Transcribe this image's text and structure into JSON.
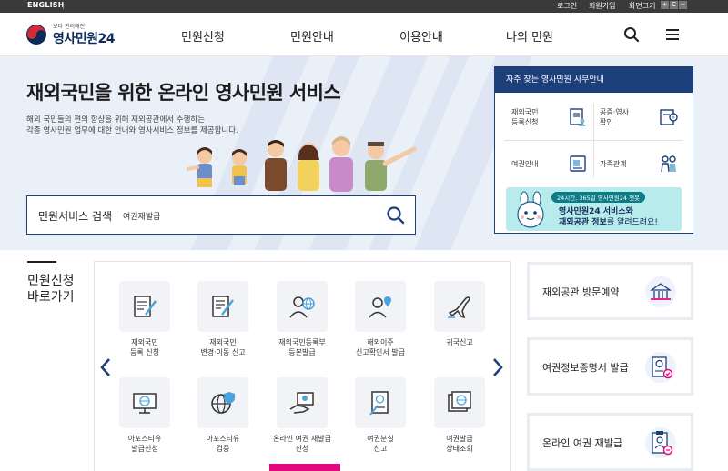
{
  "topbar": {
    "english": "ENGLISH",
    "login": "로그인",
    "signup": "회원가입",
    "zoom_label": "화면크기",
    "zoom_plus": "+",
    "zoom_reset": "C",
    "zoom_minus": "−"
  },
  "header": {
    "logo_tagline": "보다 편리해진",
    "logo_name": "영사민원24",
    "nav": [
      "민원신청",
      "민원안내",
      "이용안내",
      "나의 민원"
    ],
    "icons": [
      "search-icon",
      "menu-icon"
    ]
  },
  "hero": {
    "title": "재외국민을 위한 온라인 영사민원 서비스",
    "desc_line1": "해외 국민들의 편의 향상을 위해 재외공관에서 수행하는",
    "desc_line2": "각종 영사민원 업무에 대한 안내와 영사서비스 정보를 제공합니다.",
    "search_label": "민원서비스 검색",
    "search_value": "여권재발급"
  },
  "panel": {
    "title": "자주 찾는 영사민원 사무안내",
    "items": [
      {
        "label1": "재외국민",
        "label2": "등록신청",
        "icon": "document-person-icon"
      },
      {
        "label1": "공증·영사",
        "label2": "확인",
        "icon": "certificate-icon"
      },
      {
        "label1": "여권안내",
        "label2": "",
        "icon": "passport-icon"
      },
      {
        "label1": "가족관계",
        "label2": "",
        "icon": "family-icon"
      }
    ],
    "banner": {
      "pill": "24시간, 365일 영사민원24 챗봇",
      "line1": "영사민원24 서비스와",
      "line2_bold": "재외공관 정보",
      "line2_rest": "를 알려드려요!"
    }
  },
  "quick": {
    "title_line1": "민원신청",
    "title_line2": "바로가기",
    "services": [
      {
        "l1": "재외국민",
        "l2": "등록 신청",
        "icon": "pen-document-icon"
      },
      {
        "l1": "재외국민",
        "l2": "변경·이동 신고",
        "icon": "edit-document-icon"
      },
      {
        "l1": "재외국민등록부",
        "l2": "등본발급",
        "icon": "person-globe-icon"
      },
      {
        "l1": "해외이주",
        "l2": "신고확인서 발급",
        "icon": "person-location-icon"
      },
      {
        "l1": "귀국신고",
        "l2": "",
        "icon": "airplane-icon"
      },
      {
        "l1": "아포스티유",
        "l2": "발급신청",
        "icon": "monitor-globe-icon"
      },
      {
        "l1": "아포스티유",
        "l2": "검증",
        "icon": "globe-shield-icon"
      },
      {
        "l1": "온라인 여권 재발급",
        "l2": "신청",
        "icon": "hand-card-icon"
      },
      {
        "l1": "여권분실",
        "l2": "신고",
        "icon": "passport-pen-icon"
      },
      {
        "l1": "여권발급",
        "l2": "상태조회",
        "icon": "window-globe-icon"
      }
    ]
  },
  "side_cards": [
    {
      "label": "재외공관 방문예약",
      "icon": "embassy-icon"
    },
    {
      "label": "여권정보증명서 발급",
      "icon": "passport-certificate-icon"
    },
    {
      "label": "온라인 여권 재발급",
      "icon": "clipboard-person-icon"
    }
  ],
  "colors": {
    "navy": "#1d3f7a",
    "hero_bg": "#eaf0f8",
    "banner_bg": "#b8ecec",
    "accent_pink": "#e5097f"
  }
}
